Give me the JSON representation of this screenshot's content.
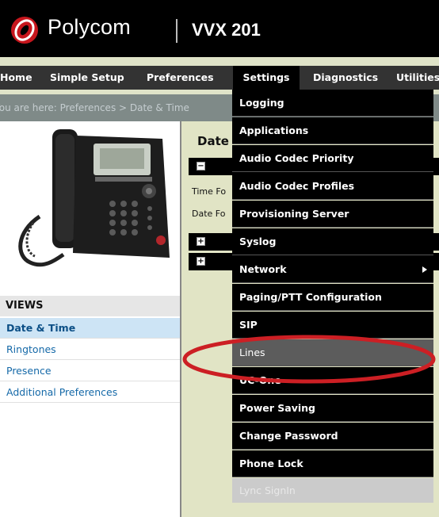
{
  "header": {
    "brand": "Polycom",
    "model": "VVX 201"
  },
  "nav": [
    "Home",
    "Simple Setup",
    "Preferences",
    "Settings",
    "Diagnostics",
    "Utilities"
  ],
  "breadcrumb": "You are here: Preferences > Date & Time",
  "sidebar": {
    "views_title": "VIEWS",
    "items": [
      "Date & Time",
      "Ringtones",
      "Presence",
      "Additional Preferences"
    ]
  },
  "main": {
    "title": "Date",
    "time_format_label": "Time Fo",
    "date_format_label": "Date Fo"
  },
  "settings_menu": [
    "Logging",
    "Applications",
    "Audio Codec Priority",
    "Audio Codec Profiles",
    "Provisioning Server",
    "Syslog",
    "Network",
    "Paging/PTT Configuration",
    "SIP",
    "Lines",
    "UC-One",
    "Power Saving",
    "Change Password",
    "Phone Lock",
    "Lync SignIn"
  ],
  "colors": {
    "accent_red": "#c7161d",
    "menu_bg": "#000000",
    "highlight": "#5c5c5c"
  }
}
